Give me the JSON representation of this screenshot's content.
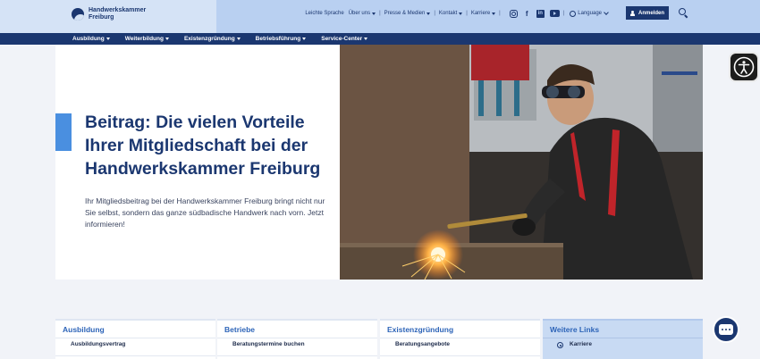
{
  "header": {
    "logo_line1": "Handwerkskammer",
    "logo_line2": "Freiburg",
    "top_links": [
      "Leichte Sprache",
      "Über uns",
      "Presse & Medien",
      "Kontakt",
      "Karriere"
    ],
    "language_label": "Language",
    "login_label": "Anmelden"
  },
  "main_nav": [
    "Ausbildung",
    "Weiterbildung",
    "Existenzgründung",
    "Betriebsführung",
    "Service-Center"
  ],
  "hero": {
    "title": "Beitrag: Die vielen Vorteile Ihrer Mitgliedschaft bei der Handwerkskammer Freiburg",
    "text": "Ihr Mitgliedsbeitrag bei der Handwerkskammer Freiburg bringt nicht nur Sie selbst, sondern das ganze südbadische Handwerk nach vorn. Jetzt informieren!"
  },
  "cards": [
    {
      "title": "Ausbildung",
      "item": "Ausbildungsvertrag"
    },
    {
      "title": "Betriebe",
      "item": "Beratungstermine buchen"
    },
    {
      "title": "Existenzgründung",
      "item": "Beratungsangebote"
    },
    {
      "title": "Weitere Links",
      "item": "Karriere"
    }
  ],
  "colors": {
    "brand_navy": "#1b3770",
    "header_light": "#b9d0f1",
    "accent_blue": "#4a8fe0"
  }
}
